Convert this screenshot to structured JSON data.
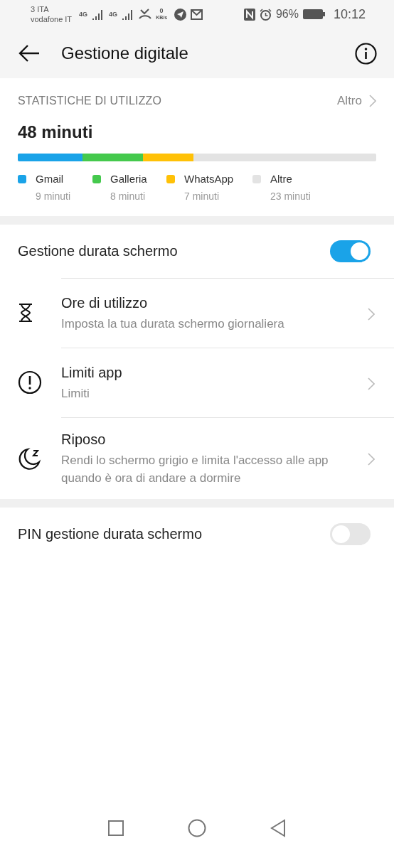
{
  "status_bar": {
    "carrier_1": "3 ITA",
    "carrier_2": "vodafone IT",
    "network_1": "4G",
    "network_2": "4G",
    "speed": "0",
    "speed_unit": "KB/s",
    "battery": "96%",
    "time": "10:12"
  },
  "header": {
    "title": "Gestione digitale"
  },
  "stats": {
    "heading": "STATISTICHE DI UTILIZZO",
    "more": "Altro",
    "total": "48 minuti",
    "apps": [
      {
        "name": "Gmail",
        "time": "9 minuti",
        "color": "#1aa3e8"
      },
      {
        "name": "Galleria",
        "time": "8 minuti",
        "color": "#45c94d"
      },
      {
        "name": "WhatsApp",
        "time": "7 minuti",
        "color": "#ffc107"
      },
      {
        "name": "Altre",
        "time": "23 minuti",
        "color": "#e3e3e3"
      }
    ]
  },
  "screen_time": {
    "label": "Gestione durata schermo",
    "on": true,
    "items": [
      {
        "kind": "hourglass",
        "title": "Ore di utilizzo",
        "subtitle": "Imposta la tua durata schermo giornaliera"
      },
      {
        "kind": "alert",
        "title": "Limiti app",
        "subtitle": "Limiti"
      },
      {
        "kind": "moon",
        "title": "Riposo",
        "subtitle": "Rendi lo schermo grigio e limita l'accesso alle app quando è ora di andare a dormire"
      }
    ]
  },
  "pin": {
    "label": "PIN gestione durata schermo",
    "on": false
  }
}
